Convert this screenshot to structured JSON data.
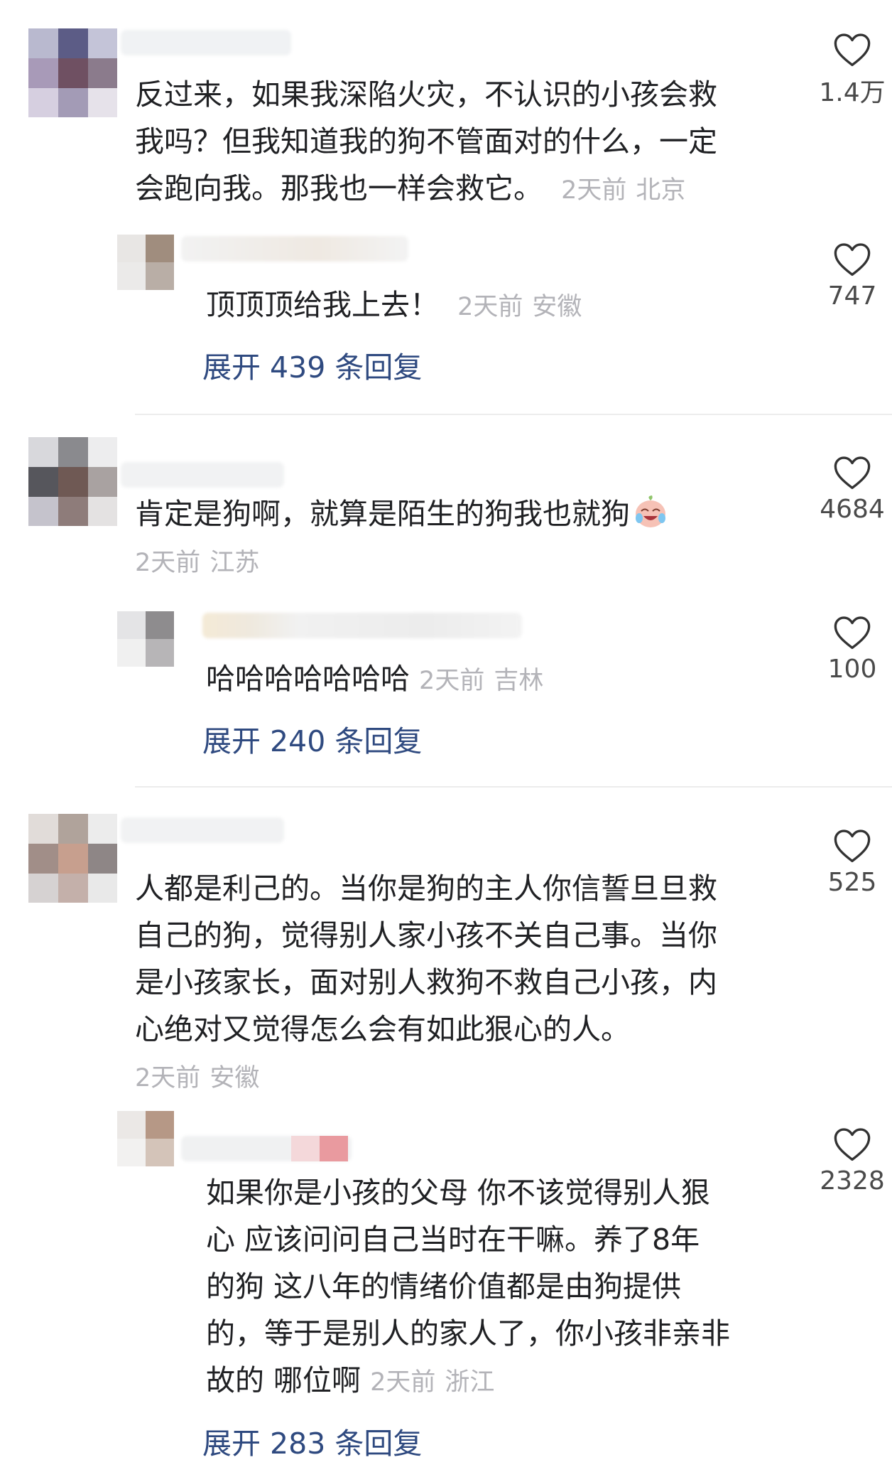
{
  "comments": [
    {
      "text_lines": [
        "反过来，如果我深陷火灾，不认识的小孩会救",
        "我吗？但我知道我的狗不管面对的什么，一定",
        "会跑向我。那我也一样会救它。"
      ],
      "time": "2天前",
      "location": "北京",
      "likes": "1.4万",
      "reply": {
        "text": "顶顶顶给我上去！",
        "time": "2天前",
        "location": "安徽",
        "likes": "747"
      },
      "expand": "展开 439 条回复"
    },
    {
      "text_lines": [
        "肯定是狗啊，就算是陌生的狗我也就狗"
      ],
      "time": "2天前",
      "location": "江苏",
      "likes": "4684",
      "reply": {
        "text": "哈哈哈哈哈哈哈",
        "time": "2天前",
        "location": "吉林",
        "likes": "100"
      },
      "expand": "展开 240 条回复"
    },
    {
      "text_lines": [
        "人都是利己的。当你是狗的主人你信誓旦旦救",
        "自己的狗，觉得别人家小孩不关自己事。当你",
        "是小孩家长，面对别人救狗不救自己小孩，内",
        "心绝对又觉得怎么会有如此狠心的人。"
      ],
      "time": "2天前",
      "location": "安徽",
      "likes": "525",
      "reply": {
        "text_lines": [
          "如果你是小孩的父母 你不该觉得别人狠",
          "心 应该问问自己当时在干嘛。养了8年",
          "的狗 这八年的情绪价值都是由狗提供",
          "的，等于是别人的家人了，你小孩非亲非",
          "故的 哪位啊"
        ],
        "time": "2天前",
        "location": "浙江",
        "likes": "2328"
      },
      "expand": "展开 283 条回复"
    }
  ],
  "icons": {
    "like": "heart-outline-icon",
    "emoji": "crying-laughing-emoji-icon"
  },
  "colors": {
    "link": "#2f4a80",
    "meta": "#b3b3b8"
  }
}
